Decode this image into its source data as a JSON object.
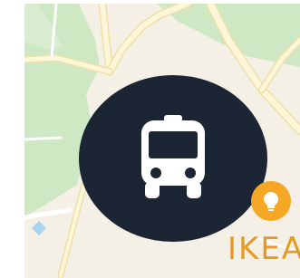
{
  "map": {
    "colors": {
      "land": "#f5f0e6",
      "park": "#cde8c2",
      "road_fill": "#fdf6d8",
      "road_edge": "#f0e0a8",
      "water": "#a8d4f0"
    },
    "markers": [
      {
        "kind": "transit-stop",
        "icon": "bus-icon",
        "color": "#1b2533"
      }
    ],
    "pois": [
      {
        "label": "IKEA",
        "icon": "bulb-icon",
        "color": "#f6a723"
      }
    ]
  }
}
